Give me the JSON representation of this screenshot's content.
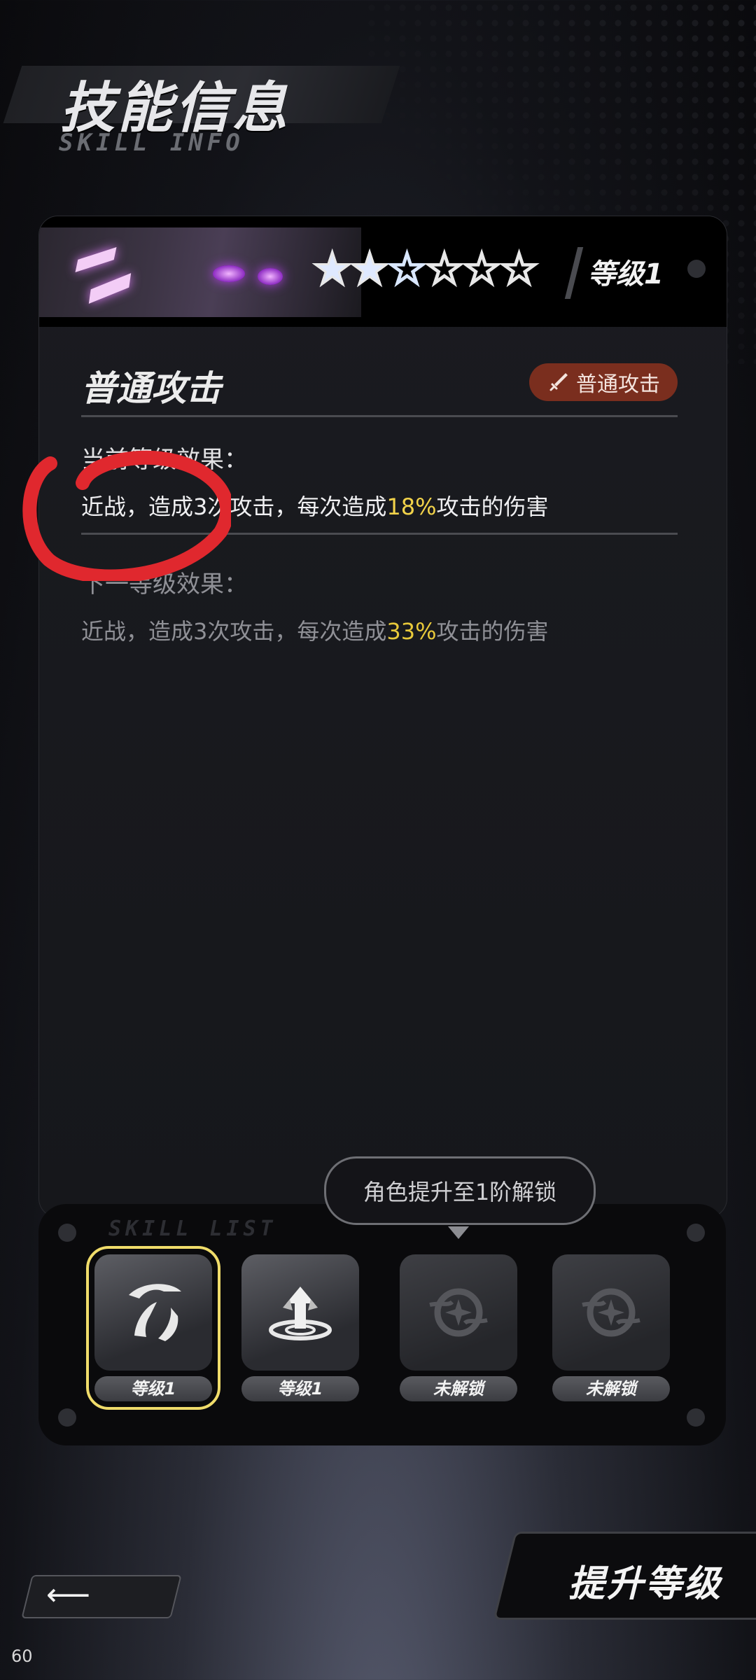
{
  "header": {
    "title": "技能信息",
    "subtitle": "SKILL INFO"
  },
  "card": {
    "stars_total": 6,
    "stars_filled": 2,
    "stars_half": 1,
    "level_label": "等级1",
    "skill_name": "普通攻击",
    "skill_tag": "普通攻击",
    "tag_color": "#7a2e1e",
    "current_label": "当前等级效果：",
    "current_desc_prefix": "近战，造成3次攻击，每次造成",
    "current_desc_value": "18%",
    "current_desc_suffix": "攻击的伤害",
    "next_label": "下一等级效果：",
    "next_desc_prefix": "近战，造成3次攻击，每次造成",
    "next_desc_value": "33%",
    "next_desc_suffix": "攻击的伤害",
    "highlight_color": "#f2d34a"
  },
  "unlock_hint": "角色提升至1阶解锁",
  "tray": {
    "label": "SKILL LIST",
    "slots": [
      {
        "icon": "claw-slash-icon",
        "caption": "等级1",
        "selected": true,
        "locked": false
      },
      {
        "icon": "power-up-arrow-icon",
        "caption": "等级1",
        "selected": false,
        "locked": false
      },
      {
        "icon": "locked-emblem-icon",
        "caption": "未解锁",
        "selected": false,
        "locked": true
      },
      {
        "icon": "locked-emblem-icon",
        "caption": "未解锁",
        "selected": false,
        "locked": true
      }
    ]
  },
  "footer": {
    "back_icon": "arrow-left-icon",
    "upgrade_label": "提升等级",
    "fps": "60"
  },
  "annotation_color": "#e0282e"
}
